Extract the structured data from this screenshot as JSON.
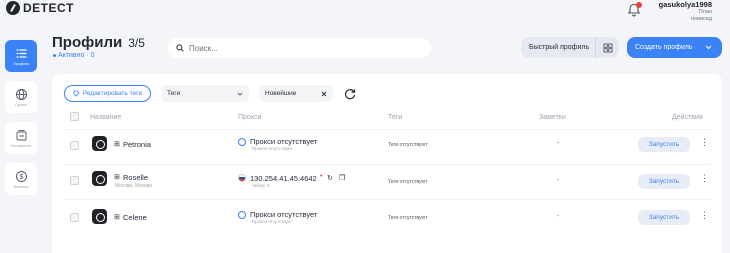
{
  "brand": {
    "logo_text": "DETECT"
  },
  "user": {
    "name": "gasukolya1998",
    "plan_line1": "План",
    "plan_line2": "новисед"
  },
  "sidebar": {
    "items": [
      {
        "label": "Профили",
        "icon": "list-icon",
        "active": true
      },
      {
        "label": "Прокси",
        "icon": "globe-icon",
        "active": false
      },
      {
        "label": "Расширения",
        "icon": "extensions-icon",
        "active": false
      },
      {
        "label": "Финансы",
        "icon": "dollar-icon",
        "active": false
      }
    ]
  },
  "header": {
    "title": "Профили",
    "count": "3/5",
    "status": "Активно · 0"
  },
  "search": {
    "placeholder": "Поиск..."
  },
  "actions": {
    "quick_profile": "Быстрый профиль",
    "create_profile": "Создать профиль"
  },
  "filters": {
    "edit_tags": "Редактировать теги",
    "tags_select": "Теги",
    "sort_select": "Новейшие"
  },
  "table": {
    "columns": [
      "Название",
      "Прокси",
      "Теги",
      "Заметки",
      "Действия"
    ],
    "rows": [
      {
        "name": "Petronia",
        "subtitle": "",
        "proxy": "Прокси отсутствует",
        "proxy_sub": "Прокси отсутствует",
        "tags": "Теги отсутствуют",
        "notes": "-",
        "action": "Запустить"
      },
      {
        "name": "Roselle",
        "subtitle": "Москва, Москва",
        "proxy": "130.254.41.45:4642",
        "proxy_sub": "Чекер: 0",
        "tags": "Теги отсутствуют",
        "notes": "-",
        "action": "Запустить"
      },
      {
        "name": "Celene",
        "subtitle": "",
        "proxy": "Прокси отсутствует",
        "proxy_sub": "Прокси отсутствует",
        "tags": "Теги отсутствуют",
        "notes": "-",
        "action": "Запустить"
      }
    ]
  },
  "colors": {
    "accent": "#3b82f6",
    "notification": "#e8433e"
  }
}
